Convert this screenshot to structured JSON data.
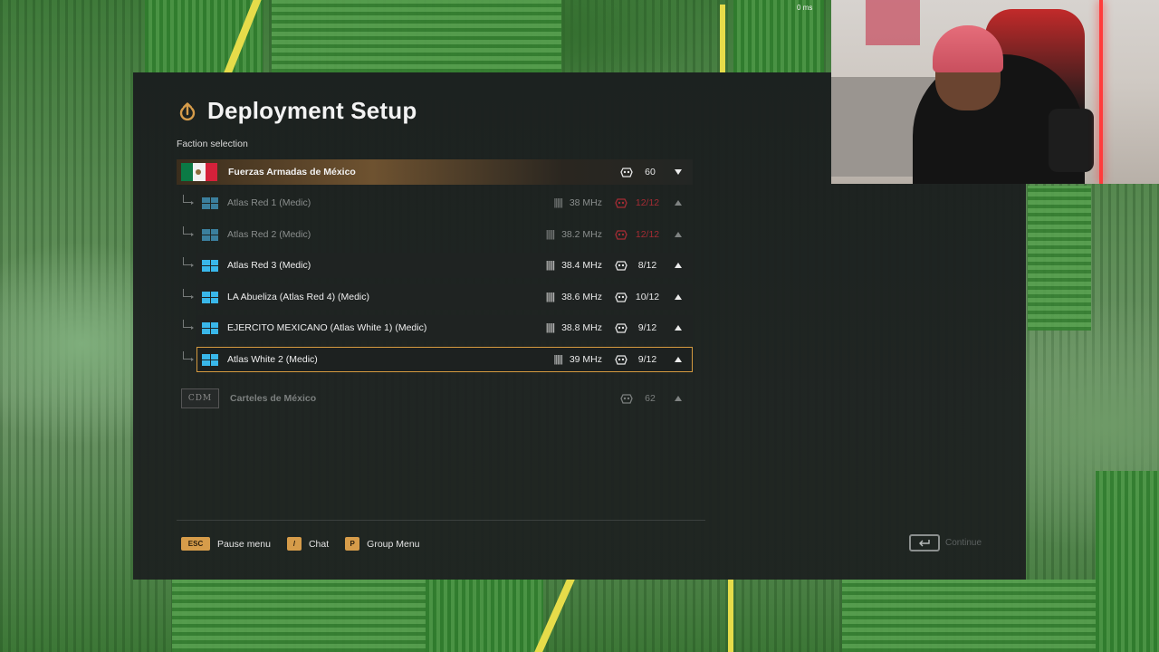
{
  "header": {
    "title": "Deployment Setup",
    "faction_label": "Faction selection"
  },
  "top_stat": "0 ms",
  "factions": [
    {
      "name": "Fuerzas Armadas de México",
      "count": "60",
      "groups": [
        {
          "name": "Atlas Red 1 (Medic)",
          "freq": "38 MHz",
          "slots": "12/12",
          "full": true
        },
        {
          "name": "Atlas Red 2 (Medic)",
          "freq": "38.2 MHz",
          "slots": "12/12",
          "full": true
        },
        {
          "name": "Atlas Red 3 (Medic)",
          "freq": "38.4 MHz",
          "slots": "8/12",
          "full": false
        },
        {
          "name": "LA Abueliza (Atlas Red 4) (Medic)",
          "freq": "38.6 MHz",
          "slots": "10/12",
          "full": false
        },
        {
          "name": "EJERCITO MEXICANO (Atlas White 1) (Medic)",
          "freq": "38.8 MHz",
          "slots": "9/12",
          "full": false
        },
        {
          "name": "Atlas White 2 (Medic)",
          "freq": "39 MHz",
          "slots": "9/12",
          "full": false,
          "selected": true
        }
      ]
    },
    {
      "name": "Carteles de México",
      "logo_text": "CDM",
      "count": "62"
    }
  ],
  "footer": {
    "esc_key": "ESC",
    "pause_label": "Pause menu",
    "chat_key": "/",
    "chat_label": "Chat",
    "group_key": "P",
    "group_label": "Group Menu",
    "continue_label": "Continue"
  },
  "colors": {
    "accent": "#d69c4a",
    "group_icon": "#39b7ea",
    "full_slots": "#a52c34"
  }
}
